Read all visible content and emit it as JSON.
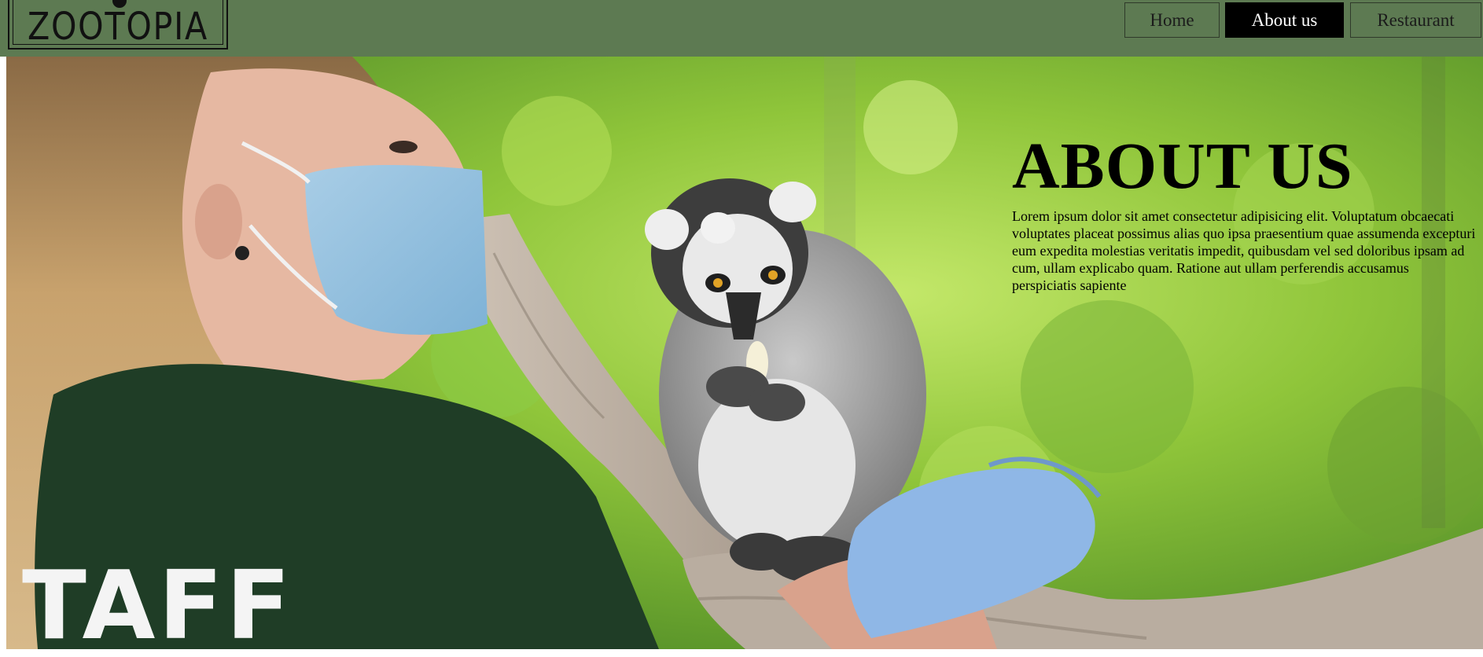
{
  "header": {
    "logo_text": "ZOOTOPIA",
    "nav": [
      {
        "label": "Home",
        "active": false
      },
      {
        "label": "About us",
        "active": true
      },
      {
        "label": "Restaurant",
        "active": false
      }
    ]
  },
  "hero": {
    "title": "ABOUT US",
    "body": "Lorem ipsum dolor sit amet consectetur adipisicing elit. Voluptatum obcaecati voluptates placeat possimus alias quo ipsa praesentium quae assumenda excepturi eum expedita molestias veritatis impedit, quibusdam vel sed doloribus ipsam ad cum, ullam explicabo quam. Ratione aut ullam perferendis accusamus perspiciatis sapiente",
    "photo_shirt_text": "TAFF"
  },
  "colors": {
    "header_bg": "#5d7a52",
    "nav_active_bg": "#000000",
    "nav_active_text": "#ffffff",
    "foliage": "#9ccf3c"
  }
}
